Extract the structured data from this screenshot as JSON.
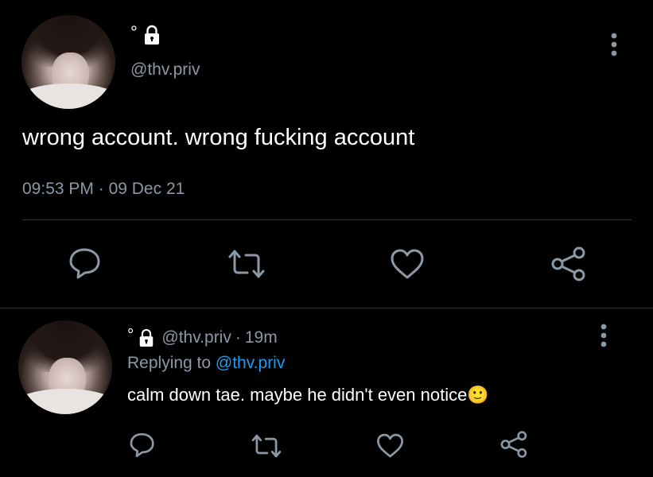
{
  "main_tweet": {
    "name_symbol": "°",
    "lock_icon": "lock-icon",
    "handle": "@thv.priv",
    "text": "wrong account. wrong fucking account",
    "time": "09:53 PM",
    "separator": "·",
    "date": "09 Dec 21",
    "actions": [
      "reply-icon",
      "retweet-icon",
      "like-icon",
      "share-icon"
    ]
  },
  "reply": {
    "name_symbol": "°",
    "handle": "@thv.priv",
    "separator": "·",
    "age": "19m",
    "replying_prefix": "Replying to",
    "replying_handle": "@thv.priv",
    "text": "calm down tae. maybe he didn't even notice",
    "emoji": "🙂",
    "actions": [
      "reply-icon",
      "retweet-icon",
      "like-icon",
      "share-icon"
    ]
  },
  "colors": {
    "background": "#000000",
    "text": "#ffffff",
    "muted": "#8b98a5",
    "link": "#1d9bf0",
    "divider": "#2f3336"
  }
}
